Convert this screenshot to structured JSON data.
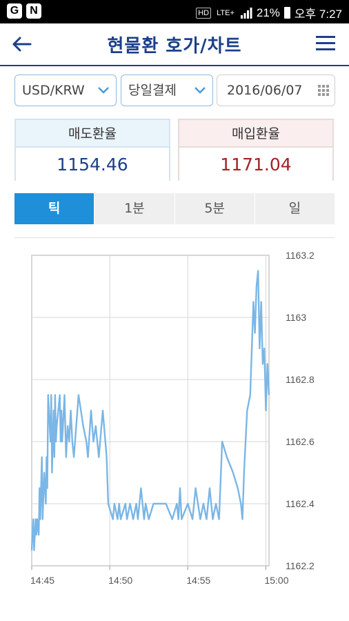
{
  "status_bar": {
    "battery": "21%",
    "time": "오후 7:27",
    "network": "LTE+"
  },
  "header": {
    "title": "현물환 호가/차트",
    "back_icon": "back-arrow-icon",
    "menu_icon": "hamburger-menu-icon"
  },
  "filters": {
    "currency": "USD/KRW",
    "settlement": "당일결제",
    "date": "2016/06/07"
  },
  "rates": {
    "sell_label": "매도환율",
    "sell_value": "1154.46",
    "buy_label": "매입환율",
    "buy_value": "1171.04",
    "sell_color": "#1c3f8a",
    "buy_color": "#a02424"
  },
  "tabs": [
    {
      "label": "틱",
      "active": true
    },
    {
      "label": "1분",
      "active": false
    },
    {
      "label": "5분",
      "active": false
    },
    {
      "label": "일",
      "active": false
    }
  ],
  "chart_data": {
    "type": "line",
    "title": "",
    "xlabel": "",
    "ylabel": "",
    "x_ticks": [
      "14:45",
      "14:50",
      "14:55",
      "15:00"
    ],
    "y_ticks": [
      "1163.2",
      "1163",
      "1162.8",
      "1162.6",
      "1162.4",
      "1162.2"
    ],
    "ylim": [
      1162.2,
      1163.2
    ],
    "xlim_minutes": [
      0,
      15.2
    ],
    "grid": true,
    "series_color": "#7ab6e6",
    "series": [
      {
        "name": "",
        "x": [
          0.0,
          0.1,
          0.15,
          0.25,
          0.3,
          0.35,
          0.45,
          0.5,
          0.55,
          0.65,
          0.7,
          0.8,
          0.9,
          0.95,
          1.0,
          1.05,
          1.2,
          1.25,
          1.3,
          1.4,
          1.45,
          1.5,
          1.55,
          1.6,
          1.7,
          1.8,
          1.85,
          1.9,
          1.95,
          2.0,
          2.1,
          2.2,
          2.3,
          2.4,
          2.5,
          2.6,
          2.7,
          3.0,
          3.3,
          3.5,
          3.6,
          3.8,
          3.95,
          4.1,
          4.3,
          4.55,
          4.8,
          4.9,
          5.2,
          5.3,
          5.5,
          5.6,
          5.7,
          6.0,
          6.1,
          6.3,
          6.5,
          6.7,
          6.8,
          7.0,
          7.2,
          7.3,
          7.5,
          7.8,
          8.0,
          8.3,
          8.6,
          9.0,
          9.3,
          9.4,
          9.5,
          9.6,
          10.0,
          10.3,
          10.5,
          10.8,
          11.0,
          11.2,
          11.4,
          11.6,
          11.8,
          12.0,
          12.2,
          12.5,
          12.9,
          13.2,
          13.4,
          13.5,
          13.6,
          13.8,
          14.0,
          14.2,
          14.3,
          14.4,
          14.5,
          14.6,
          14.7,
          14.8,
          14.9,
          15.0,
          15.1,
          15.2
        ],
        "y": [
          1162.25,
          1162.35,
          1162.25,
          1162.35,
          1162.3,
          1162.35,
          1162.3,
          1162.45,
          1162.35,
          1162.55,
          1162.35,
          1162.5,
          1162.4,
          1162.55,
          1162.45,
          1162.75,
          1162.6,
          1162.75,
          1162.5,
          1162.7,
          1162.55,
          1162.75,
          1162.6,
          1162.65,
          1162.7,
          1162.75,
          1162.6,
          1162.7,
          1162.6,
          1162.65,
          1162.75,
          1162.55,
          1162.65,
          1162.6,
          1162.7,
          1162.6,
          1162.55,
          1162.75,
          1162.65,
          1162.6,
          1162.55,
          1162.7,
          1162.6,
          1162.65,
          1162.55,
          1162.7,
          1162.55,
          1162.4,
          1162.35,
          1162.4,
          1162.35,
          1162.4,
          1162.35,
          1162.4,
          1162.35,
          1162.4,
          1162.35,
          1162.4,
          1162.35,
          1162.45,
          1162.35,
          1162.4,
          1162.35,
          1162.4,
          1162.4,
          1162.4,
          1162.4,
          1162.35,
          1162.4,
          1162.35,
          1162.45,
          1162.35,
          1162.4,
          1162.35,
          1162.45,
          1162.35,
          1162.4,
          1162.35,
          1162.45,
          1162.35,
          1162.4,
          1162.35,
          1162.6,
          1162.55,
          1162.5,
          1162.45,
          1162.4,
          1162.35,
          1162.5,
          1162.7,
          1162.75,
          1163.05,
          1162.95,
          1163.1,
          1163.15,
          1162.9,
          1163.05,
          1162.85,
          1162.9,
          1162.7,
          1162.85,
          1162.75
        ]
      }
    ]
  }
}
